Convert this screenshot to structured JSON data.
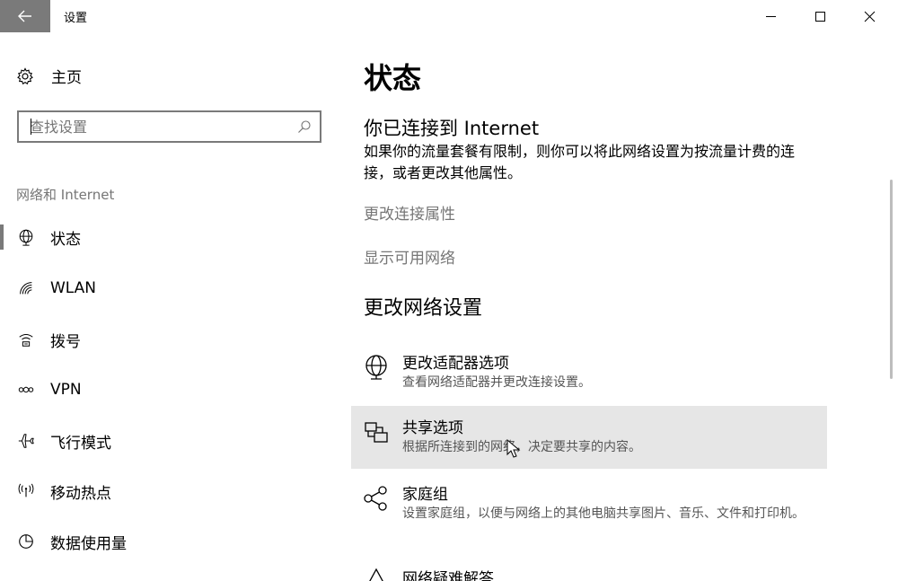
{
  "window": {
    "title": "设置"
  },
  "sidebar": {
    "home_label": "主页",
    "search_placeholder": "查找设置",
    "section_label": "网络和 Internet",
    "items": [
      {
        "label": "状态",
        "icon": "globe-icon",
        "selected": true
      },
      {
        "label": "WLAN",
        "icon": "wifi-icon",
        "selected": false
      },
      {
        "label": "拨号",
        "icon": "dialup-icon",
        "selected": false
      },
      {
        "label": "VPN",
        "icon": "vpn-icon",
        "selected": false
      },
      {
        "label": "飞行模式",
        "icon": "airplane-icon",
        "selected": false
      },
      {
        "label": "移动热点",
        "icon": "hotspot-icon",
        "selected": false
      },
      {
        "label": "数据使用量",
        "icon": "data-usage-icon",
        "selected": false
      }
    ]
  },
  "main": {
    "page_title": "状态",
    "connection_heading": "你已连接到 Internet",
    "connection_desc": "如果你的流量套餐有限制，则你可以将此网络设置为按流量计费的连接，或者更改其他属性。",
    "links": [
      "更改连接属性",
      "显示可用网络"
    ],
    "section_heading": "更改网络设置",
    "options": [
      {
        "title": "更改适配器选项",
        "desc": "查看网络适配器并更改连接设置。",
        "icon": "adapter-icon"
      },
      {
        "title": "共享选项",
        "desc": "根据所连接到的网络，决定要共享的内容。",
        "icon": "sharing-icon"
      },
      {
        "title": "家庭组",
        "desc": "设置家庭组，以便与网络上的其他电脑共享图片、音乐、文件和打印机。",
        "icon": "homegroup-icon"
      },
      {
        "title": "网络疑难解答",
        "desc": "",
        "icon": "troubleshoot-icon"
      }
    ]
  }
}
